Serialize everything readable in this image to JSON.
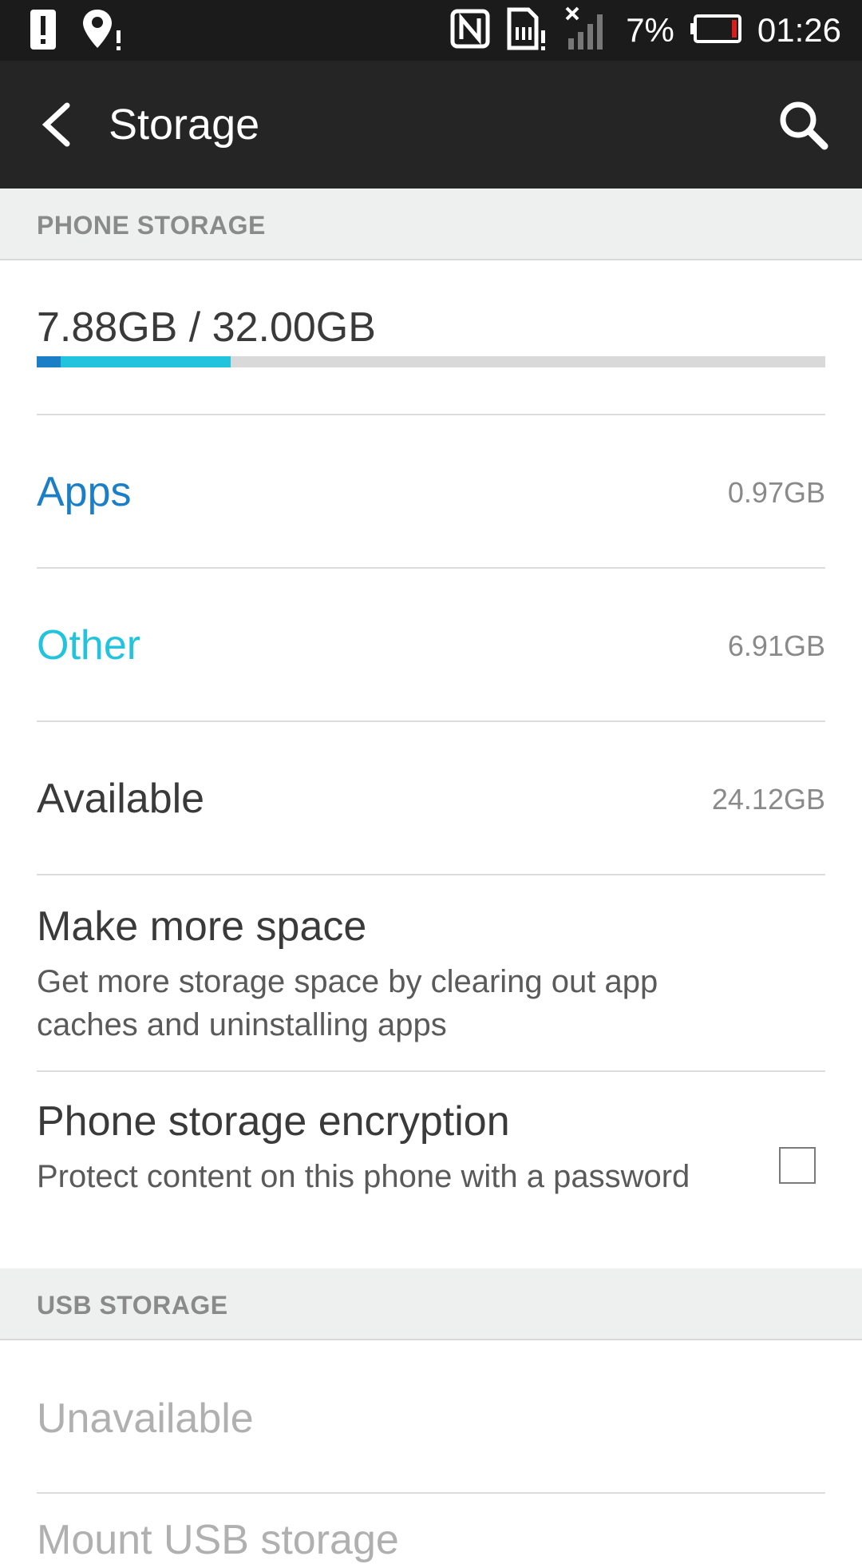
{
  "status_bar": {
    "battery_percent": "7%",
    "time": "01:26",
    "icons": [
      "alert-icon",
      "location-alert-icon",
      "nfc-icon",
      "sim-alert-icon",
      "signal-off-icon",
      "battery-low-icon"
    ]
  },
  "app_bar": {
    "title": "Storage",
    "back_icon": "back-arrow-icon",
    "search_icon": "search-icon"
  },
  "phone_storage": {
    "header": "PHONE STORAGE",
    "summary": "7.88GB / 32.00GB",
    "usage_fractions": {
      "apps": 0.0303,
      "other": 0.2159
    },
    "colors": {
      "apps": "#1a7fc7",
      "other": "#22c3dc",
      "free": "#d9d9d9"
    },
    "rows": [
      {
        "label": "Apps",
        "value": "0.97GB"
      },
      {
        "label": "Other",
        "value": "6.91GB"
      },
      {
        "label": "Available",
        "value": "24.12GB"
      }
    ],
    "make_space": {
      "title": "Make more space",
      "subtitle": "Get more storage space by clearing out app caches and uninstalling apps"
    },
    "encryption": {
      "title": "Phone storage encryption",
      "subtitle": "Protect content on this phone with a password",
      "checked": false
    }
  },
  "usb_storage": {
    "header": "USB STORAGE",
    "status": "Unavailable",
    "next_item_partial": "Mount USB storage"
  }
}
